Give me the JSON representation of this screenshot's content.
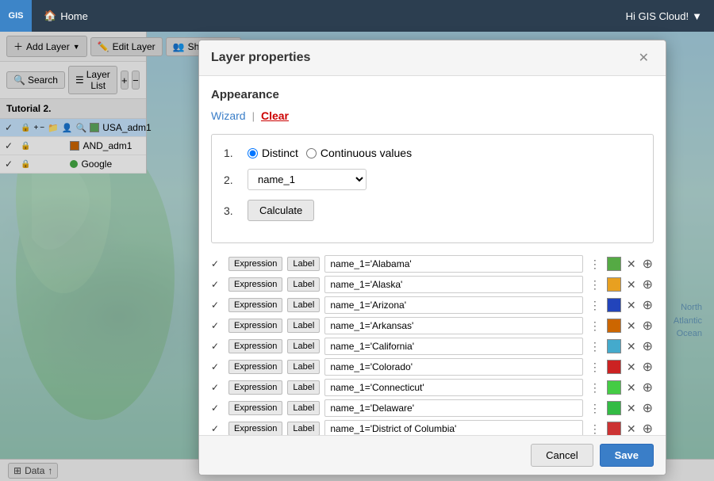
{
  "app": {
    "logo": "GIS",
    "home_label": "Home",
    "user_label": "Hi GIS Cloud!",
    "home_icon": "🏠"
  },
  "sidebar": {
    "add_layer_label": "Add Layer",
    "edit_layer_label": "Edit Layer",
    "share_label": "Share La...",
    "search_label": "Search",
    "layer_list_label": "Layer List",
    "group_title": "Tutorial 2.",
    "layers": [
      {
        "name": "USA_adm1",
        "color": "#5fa85f",
        "type": "polygon",
        "active": true
      },
      {
        "name": "AND_adm1",
        "color": "#cc6600",
        "type": "polygon",
        "active": false
      },
      {
        "name": "Google",
        "color": "#44aa44",
        "type": "dot",
        "active": false
      }
    ]
  },
  "modal": {
    "title": "Layer properties",
    "section": "Appearance",
    "wizard_label": "Wizard",
    "clear_label": "Clear",
    "option1_num": "1.",
    "option2_num": "2.",
    "option3_num": "3.",
    "distinct_label": "Distinct",
    "continuous_label": "Continuous values",
    "field_value": "name_1",
    "calculate_label": "Calculate",
    "expressions": [
      {
        "expr": "name_1='Alabama'",
        "color": "#55aa44"
      },
      {
        "expr": "name_1='Alaska'",
        "color": "#e8a020"
      },
      {
        "expr": "name_1='Arizona'",
        "color": "#2244bb"
      },
      {
        "expr": "name_1='Arkansas'",
        "color": "#cc6600"
      },
      {
        "expr": "name_1='California'",
        "color": "#44aacc"
      },
      {
        "expr": "name_1='Colorado'",
        "color": "#cc2222"
      },
      {
        "expr": "name_1='Connecticut'",
        "color": "#44cc44"
      },
      {
        "expr": "name_1='Delaware'",
        "color": "#33bb44"
      },
      {
        "expr": "name_1='District of Columbia'",
        "color": "#cc3333"
      }
    ],
    "cancel_label": "Cancel",
    "save_label": "Save"
  },
  "ocean": {
    "line1": "North",
    "line2": "Atlantic",
    "line3": "Ocean"
  },
  "bottom": {
    "data_label": "Data"
  }
}
